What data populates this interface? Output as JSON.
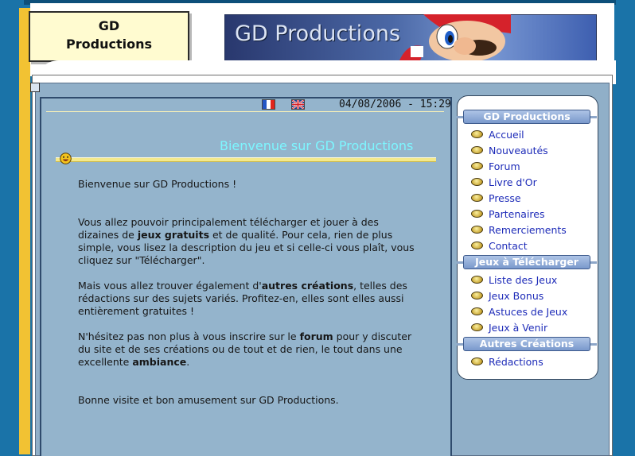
{
  "site": {
    "logo_line1": "GD",
    "logo_line2": "Productions",
    "banner_title": "GD Productions"
  },
  "main": {
    "date_time": "04/08/2006 - 15:29",
    "welcome_title": "Bienvenue sur GD Productions",
    "intro": "Bienvenue sur GD Productions !",
    "p1_a": "Vous allez pouvoir principalement télécharger et jouer à des dizaines de ",
    "p1_b": "jeux gratuits",
    "p1_c": " et de qualité. Pour cela, rien de plus simple, vous lisez la description du jeu et si celle-ci vous plaît, vous cliquez sur \"Télécharger\".",
    "p2_a": "Mais vous allez trouver également d'",
    "p2_b": "autres créations",
    "p2_c": ", telles des rédactions sur des sujets variés. Profitez-en, elles sont elles aussi entièrement gratuites !",
    "p3_a": "N'hésitez pas non plus à vous inscrire sur le ",
    "p3_b": "forum",
    "p3_c": " pour y discuter du site et de ses créations ou de tout et de rien, le tout dans une excellente ",
    "p3_d": "ambiance",
    "p3_e": ".",
    "closing": "Bonne visite et bon amusement sur GD Productions."
  },
  "nav": {
    "section1": "GD Productions",
    "section1_items": [
      "Accueil",
      "Nouveautés",
      "Forum",
      "Livre d'Or",
      "Presse",
      "Partenaires",
      "Remerciements",
      "Contact"
    ],
    "section2": "Jeux à Télécharger",
    "section2_items": [
      "Liste des Jeux",
      "Jeux Bonus",
      "Astuces de Jeux",
      "Jeux à Venir"
    ],
    "section3": "Autres Créations",
    "section3_items": [
      "Rédactions"
    ]
  },
  "colors": {
    "background": "#1a73a8",
    "panel": "#94b4cc",
    "title": "#7df6ff",
    "link": "#1d2bb8"
  }
}
